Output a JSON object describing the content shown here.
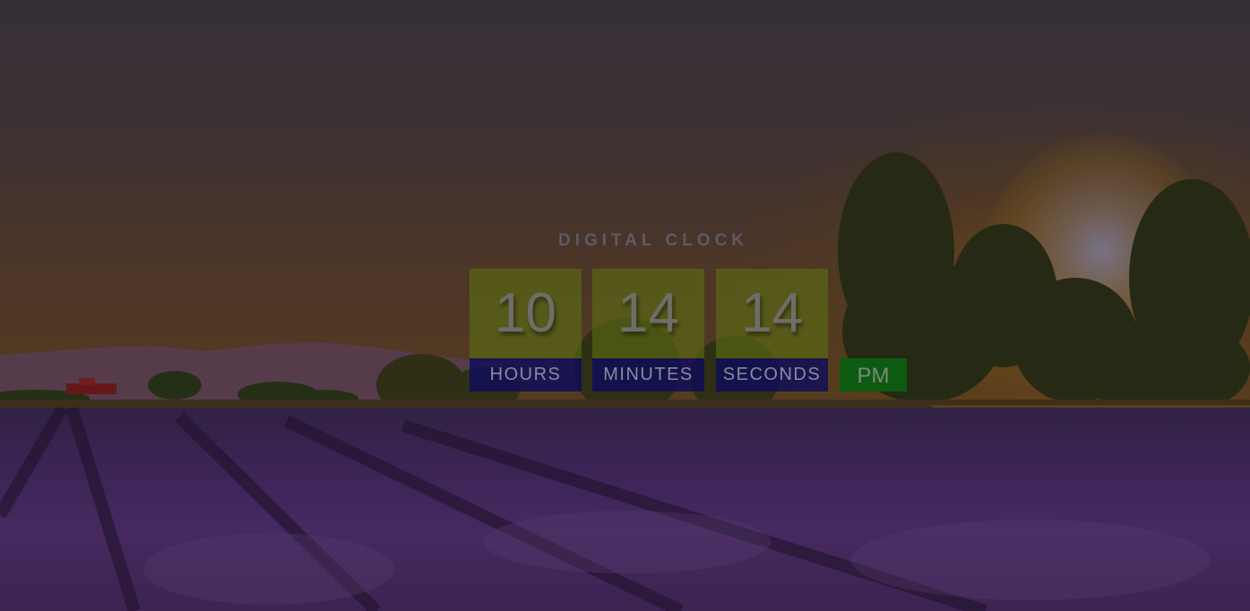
{
  "title": "DIGITAL CLOCK",
  "clock": {
    "hours": "10",
    "minutes": "14",
    "seconds": "14",
    "ampm": "PM",
    "labels": {
      "hours": "HOURS",
      "minutes": "MINUTES",
      "seconds": "SECONDS"
    }
  },
  "colors": {
    "digit_box": "#5c6e14",
    "label_box": "#0c0a5c",
    "ampm_box": "#0e5b12",
    "title_text": "#5d5a66"
  },
  "background": {
    "icon": "lavender-field-sunset-image"
  }
}
